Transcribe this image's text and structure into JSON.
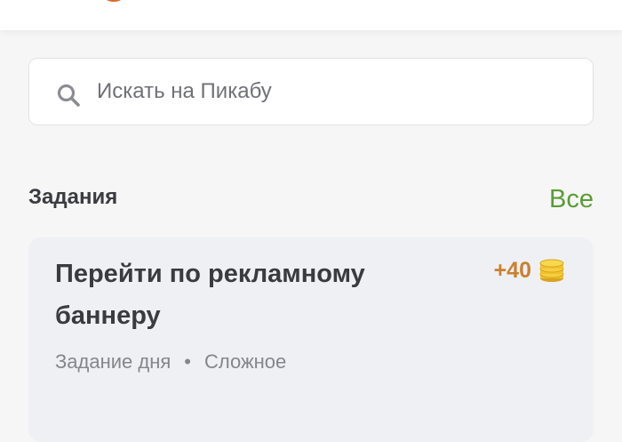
{
  "header": {
    "logo_color": "#e0662b"
  },
  "search": {
    "placeholder": "Искать на Пикабу",
    "icon": "search-icon"
  },
  "tasks_section": {
    "title": "Задания",
    "all_link": "Все",
    "accent_color": "#5a9c35"
  },
  "task": {
    "title": "Перейти по рекламному баннеру",
    "reward": "+40",
    "reward_icon": "coins-icon",
    "type": "Задание дня",
    "separator": "•",
    "difficulty": "Сложное"
  }
}
